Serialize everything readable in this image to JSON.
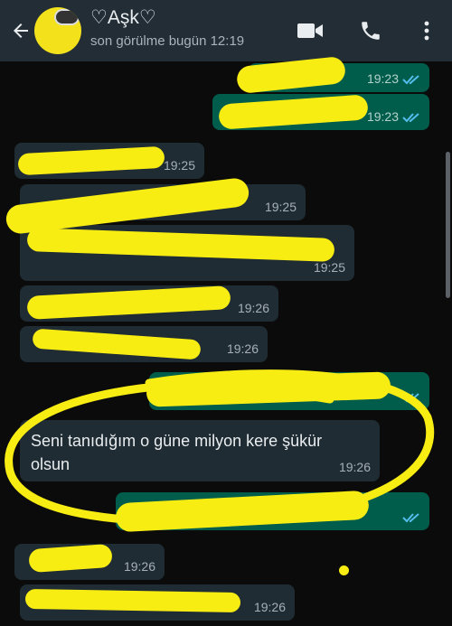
{
  "header": {
    "title": "♡Aşk♡",
    "subtitle": "son görülme bugün 12:19"
  },
  "icons": {
    "back": "arrow-left-icon",
    "video": "video-call-icon",
    "call": "phone-icon",
    "menu": "more-vert-icon"
  },
  "colors": {
    "header_bg": "#232d36",
    "incoming_bubble": "#1f2c33",
    "outgoing_bubble": "#005c4b",
    "read_ticks": "#53bdeb",
    "highlight": "#f8ed13"
  },
  "messages": [
    {
      "direction": "out",
      "text": "",
      "time": "19:23",
      "status": "read"
    },
    {
      "direction": "out",
      "text": "",
      "time": "19:23",
      "status": "read"
    },
    {
      "direction": "in",
      "text": "",
      "time": "19:25"
    },
    {
      "direction": "in",
      "text": "",
      "time": "19:25"
    },
    {
      "direction": "in",
      "text": "",
      "time": "19:25"
    },
    {
      "direction": "in",
      "text": "",
      "time": "19:26"
    },
    {
      "direction": "in",
      "text": "",
      "time": "19:26"
    },
    {
      "direction": "out",
      "text": "",
      "time": "",
      "status": "read"
    },
    {
      "direction": "in",
      "text": "Seni tanıdığım o güne milyon kere şükür olsun",
      "time": "19:26"
    },
    {
      "direction": "out",
      "text": "",
      "time": "",
      "status": "read"
    },
    {
      "direction": "in",
      "text": "",
      "time": "19:26"
    },
    {
      "direction": "in",
      "text": "",
      "time": "19:26"
    }
  ]
}
